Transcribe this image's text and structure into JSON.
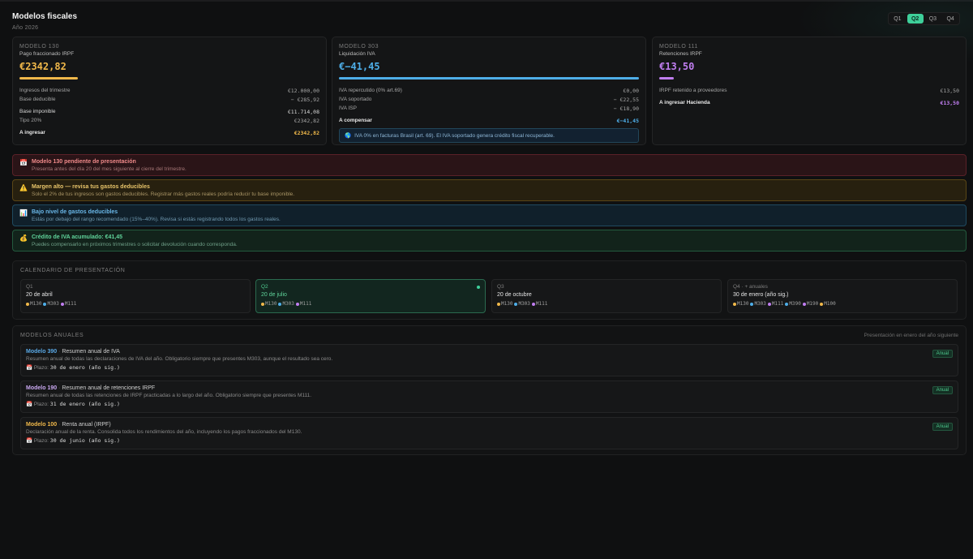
{
  "header": {
    "title": "Modelos fiscales",
    "subtitle": "Año 2026"
  },
  "quarters": [
    "Q1",
    "Q2",
    "Q3",
    "Q4"
  ],
  "active_quarter": "Q2",
  "cards": {
    "m130": {
      "kicker": "MODELO 130",
      "sub": "Pago fraccionado IRPF",
      "amount": "€2342,82",
      "color": "#f0b84a",
      "rows": [
        {
          "label": "Ingresos del trimestre",
          "value": "€12.000,00"
        },
        {
          "label": "Base deducible",
          "value": "− €285,92"
        },
        {
          "label": "Base imponible",
          "value": "€11.714,08"
        },
        {
          "label": "Tipo 20%",
          "value": "€2342,82"
        },
        {
          "label": "A ingresar",
          "value": "€2342,82"
        }
      ]
    },
    "m303": {
      "kicker": "MODELO 303",
      "sub": "Liquidación IVA",
      "amount": "€−41,45",
      "color": "#4eaee8",
      "rows": [
        {
          "label": "IVA repercutido (0% art.69)",
          "value": "€0,00"
        },
        {
          "label": "IVA soportado",
          "value": "− €22,55"
        },
        {
          "label": "IVA ISP",
          "value": "− €18,90"
        },
        {
          "label": "A compensar",
          "value": "€−41,45"
        }
      ],
      "note": "IVA 0% en facturas Brasil (art. 69). El IVA soportado genera crédito fiscal recuperable."
    },
    "m111": {
      "kicker": "MODELO 111",
      "sub": "Retenciones IRPF",
      "amount": "€13,50",
      "color": "#c07ef0",
      "rows": [
        {
          "label": "IRPF retenido a proveedores",
          "value": "€13,50"
        },
        {
          "label": "A ingresar Hacienda",
          "value": "€13,50"
        }
      ]
    }
  },
  "alerts": [
    {
      "icon": "calendar-icon",
      "title": "Modelo 130 pendiente de presentación",
      "desc": "Presenta antes del día 20 del mes siguiente al cierre del trimestre."
    },
    {
      "icon": "warning-icon",
      "title": "Margen alto — revisa tus gastos deducibles",
      "desc": "Solo el 2% de tus ingresos son gastos deducibles. Registrar más gastos reales podría reducir tu base imponible."
    },
    {
      "icon": "chart-icon",
      "title": "Bajo nivel de gastos deducibles",
      "desc": "Estás por debajo del rango recomendado (15%–40%). Revisa si estás registrando todos los gastos reales."
    },
    {
      "icon": "money-bag-icon",
      "title": "Crédito de IVA acumulado: €41,45",
      "desc": "Puedes compensarlo en próximos trimestres o solicitar devolución cuando corresponda."
    }
  ],
  "calendar": {
    "title": "CALENDARIO DE PRESENTACIÓN",
    "cells": [
      {
        "q": "Q1",
        "date": "20 de abril",
        "models": [
          "M130",
          "M303",
          "M111"
        ]
      },
      {
        "q": "Q2",
        "date": "20 de julio",
        "models": [
          "M130",
          "M303",
          "M111"
        ]
      },
      {
        "q": "Q3",
        "date": "20 de octubre",
        "models": [
          "M130",
          "M303",
          "M111"
        ]
      },
      {
        "q": "Q4 · + anuales",
        "date": "30 de enero (año sig.)",
        "models": [
          "M130",
          "M303",
          "M111",
          "M390",
          "M190",
          "M100"
        ]
      }
    ],
    "model_colors": {
      "M130": "#f0b84a",
      "M303": "#4eaee8",
      "M111": "#c07ef0",
      "M390": "#4eaee8",
      "M190": "#c07ef0",
      "M100": "#f0b84a"
    }
  },
  "annual": {
    "title": "MODELOS ANUALES",
    "hint": "Presentación en enero del año siguiente",
    "plazo_label": "Plazo:",
    "items": [
      {
        "model": "Modelo 390",
        "name": "Resumen anual de IVA",
        "desc": "Resumen anual de todas las declaraciones de IVA del año. Obligatorio siempre que presentes M303, aunque el resultado sea cero.",
        "plazo": "30 de enero (año sig.)",
        "badge": "Anual",
        "color": "#5aa9e6"
      },
      {
        "model": "Modelo 190",
        "name": "Resumen anual de retenciones IRPF",
        "desc": "Resumen anual de todas las retenciones de IRPF practicadas a lo largo del año. Obligatorio siempre que presentes M111.",
        "plazo": "31 de enero (año sig.)",
        "badge": "Anual",
        "color": "#c9a8f0"
      },
      {
        "model": "Modelo 100",
        "name": "Renta anual (IRPF)",
        "desc": "Declaración anual de la renta. Consolida todos los rendimientos del año, incluyendo los pagos fraccionados del M130.",
        "plazo": "30 de junio (año sig.)",
        "badge": "Anual",
        "color": "#f0b84a"
      }
    ]
  }
}
